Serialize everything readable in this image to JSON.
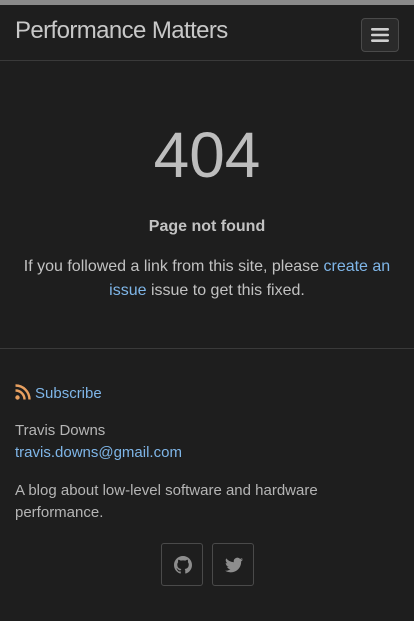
{
  "header": {
    "site_title": "Performance Matters",
    "menu_icon": "hamburger-icon"
  },
  "error": {
    "code": "404",
    "title": "Page not found",
    "message_before": "If you followed a link from this site, please ",
    "link_text": "create an issue",
    "message_after": " issue to get this fixed."
  },
  "footer": {
    "subscribe_icon": "rss-icon",
    "subscribe_label": "Subscribe",
    "author": "Travis Downs",
    "email": "travis.downs@gmail.com",
    "description": "A blog about low-level software and hardware performance.",
    "social": [
      {
        "icon": "github-icon"
      },
      {
        "icon": "twitter-icon"
      }
    ]
  },
  "colors": {
    "background": "#1e1e1e",
    "link": "#7fb6e8",
    "text": "#c2c2c2",
    "rss": "#e8a060"
  }
}
